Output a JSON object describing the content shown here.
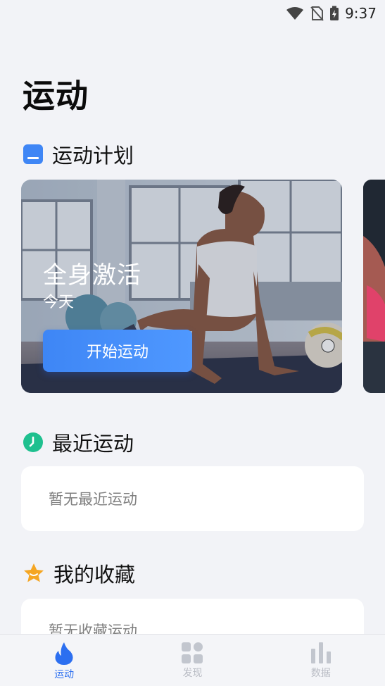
{
  "status_bar": {
    "time": "9:37"
  },
  "page": {
    "title": "运动"
  },
  "sections": {
    "plan": {
      "title": "运动计划"
    },
    "recent": {
      "title": "最近运动",
      "empty_text": "暂无最近运动"
    },
    "favorites": {
      "title": "我的收藏",
      "empty_text": "暂无收藏运动"
    }
  },
  "plan_card": {
    "title": "全身激活",
    "subtitle": "今天",
    "button_label": "开始运动"
  },
  "bottom_nav": {
    "items": [
      {
        "label": "运动",
        "icon": "flame-icon",
        "active": true
      },
      {
        "label": "发现",
        "icon": "grid-icon",
        "active": false
      },
      {
        "label": "数据",
        "icon": "bar-chart-icon",
        "active": false
      }
    ]
  },
  "colors": {
    "accent": "#2c6ff0",
    "plan_icon": "#3f86f5",
    "recent_icon": "#1fc08f",
    "fav_icon": "#f5a623",
    "background": "#f2f3f7"
  }
}
